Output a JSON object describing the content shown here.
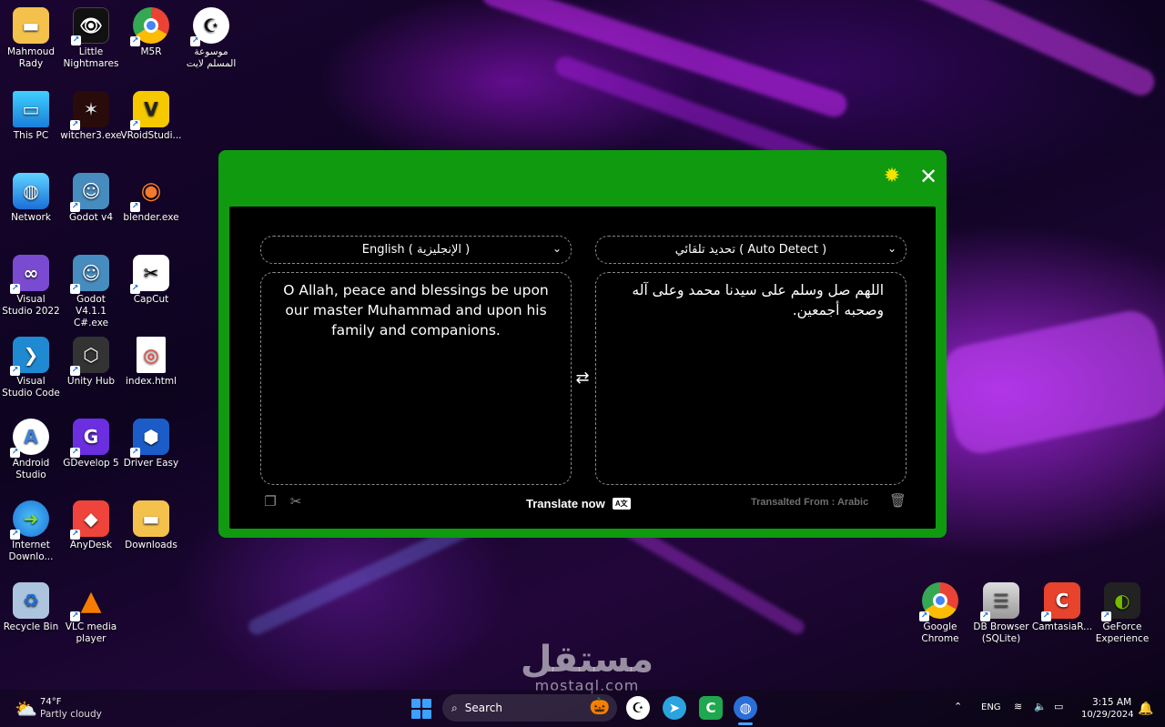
{
  "desktop": {
    "icons_left": [
      {
        "label": "Mahmoud Rady",
        "icon": "folder-icon"
      },
      {
        "label": "Little Nightmares",
        "icon": "game-icon"
      },
      {
        "label": "M5R",
        "icon": "chrome-icon"
      },
      {
        "label": "موسوعة المسلم لايت",
        "icon": "crescent-icon"
      },
      {
        "label": "This PC",
        "icon": "monitor-icon"
      },
      {
        "label": "witcher3.exe",
        "icon": "witcher-icon"
      },
      {
        "label": "VRoidStudi...",
        "icon": "vroid-icon"
      },
      {
        "label": "Network",
        "icon": "network-icon"
      },
      {
        "label": "Godot v4",
        "icon": "godot-icon"
      },
      {
        "label": "blender.exe",
        "icon": "blender-icon"
      },
      {
        "label": "Visual Studio 2022",
        "icon": "visual-studio-icon"
      },
      {
        "label": "Godot V4.1.1 C#.exe",
        "icon": "godot-icon"
      },
      {
        "label": "CapCut",
        "icon": "capcut-icon"
      },
      {
        "label": "Visual Studio Code",
        "icon": "vscode-icon"
      },
      {
        "label": "Unity Hub",
        "icon": "unity-icon"
      },
      {
        "label": "index.html",
        "icon": "html-file-icon"
      },
      {
        "label": "Android Studio",
        "icon": "android-studio-icon"
      },
      {
        "label": "GDevelop 5",
        "icon": "gdevelop-icon"
      },
      {
        "label": "Driver Easy",
        "icon": "driver-easy-icon"
      },
      {
        "label": "Internet Downlo...",
        "icon": "idm-icon"
      },
      {
        "label": "AnyDesk",
        "icon": "anydesk-icon"
      },
      {
        "label": "Downloads",
        "icon": "folder-icon"
      },
      {
        "label": "Recycle Bin",
        "icon": "recycle-bin-icon"
      },
      {
        "label": "VLC media player",
        "icon": "vlc-icon"
      }
    ],
    "icons_right": [
      {
        "label": "Google Chrome",
        "icon": "chrome-icon"
      },
      {
        "label": "DB Browser (SQLite)",
        "icon": "database-icon"
      },
      {
        "label": "CamtasiaR...",
        "icon": "camtasia-icon"
      },
      {
        "label": "GeForce Experience",
        "icon": "nvidia-icon"
      }
    ]
  },
  "translator": {
    "target_language": "English ( الإنجليزية )",
    "source_language": "تحديد تلقائي ( Auto Detect )",
    "translated_text": "O Allah, peace and blessings be upon our master Muhammad and upon his family and companions.",
    "source_text": "اللهم صل وسلم على سيدنا محمد وعلى آله وصحبه أجمعين.",
    "translate_button": "Translate now",
    "translate_badge": "A文",
    "translated_from": "Transalted From : Arabic"
  },
  "watermark": {
    "arabic": "مستقل",
    "latin": "mostaql.com"
  },
  "taskbar": {
    "weather_temp": "74°F",
    "weather_desc": "Partly cloudy",
    "search_placeholder": "Search",
    "language": "ENG",
    "time": "3:15 AM",
    "date": "10/29/2024"
  },
  "colors": {
    "window_green": "#0f9a0f",
    "gear_yellow": "#f4e400",
    "accent_blue": "#3ca0ff"
  }
}
